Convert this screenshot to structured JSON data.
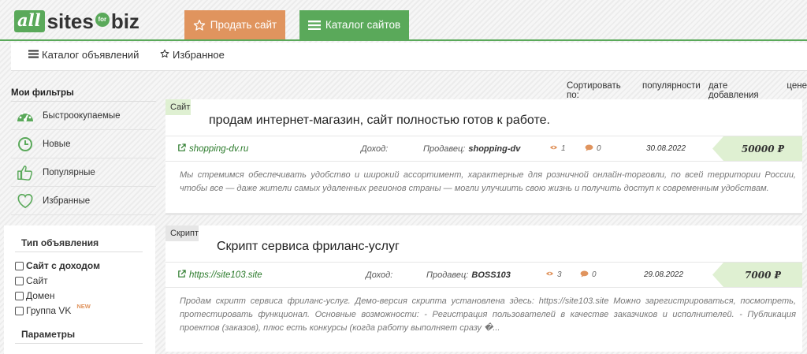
{
  "logo": {
    "part1": "all",
    "part2": "sites",
    "part3": "for",
    "part4": "biz"
  },
  "header": {
    "sell_label": "Продать сайт",
    "catalog_label": "Каталог сайтов"
  },
  "nav": {
    "catalog_ads": "Каталог объявлений",
    "favorites": "Избранное"
  },
  "sidebar": {
    "my_filters_title": "Мои фильтры",
    "filters": [
      {
        "label": "Быстроокупаемые",
        "icon": "speedometer-icon"
      },
      {
        "label": "Новые",
        "icon": "clock-icon"
      },
      {
        "label": "Популярные",
        "icon": "thumbs-up-icon"
      },
      {
        "label": "Избранные",
        "icon": "heart-icon"
      }
    ],
    "ad_type_title": "Тип объявления",
    "ad_types": [
      {
        "label": "Сайт с доходом",
        "bold": true,
        "checked": false
      },
      {
        "label": "Сайт",
        "checked": false
      },
      {
        "label": "Домен",
        "checked": false
      },
      {
        "label": "Группа VK",
        "checked": false,
        "badge": "NEW"
      }
    ],
    "params_title": "Параметры"
  },
  "sort": {
    "label": "Сортировать по:",
    "options": [
      "популярности",
      "дате добавления",
      "цене"
    ]
  },
  "listings": [
    {
      "category": "Сайт",
      "title": "продам интернет-магазин, сайт полностью готов к работе.",
      "site": "shopping-dv.ru",
      "income_label": "Доход:",
      "seller_label": "Продавец:",
      "seller": "shopping-dv",
      "views": "1",
      "comments": "0",
      "date": "30.08.2022",
      "price": "50000 ₽",
      "description": "Мы стремимся обеспечивать удобство и широкий ассортимент, характерные для розничной онлайн-торговли, по всей территории России, чтобы все — даже жители самых удаленных регионов страны — могли улучшить свою жизнь и получить доступ к современным удобствам."
    },
    {
      "category": "Скрипт",
      "title": "Скрипт сервиса фриланс-услуг",
      "site": "https://site103.site",
      "income_label": "Доход:",
      "seller_label": "Продавец:",
      "seller": "BOSS103",
      "views": "3",
      "comments": "0",
      "date": "29.08.2022",
      "price": "7000 ₽",
      "description": "Продам скрипт сервиса фриланс-услуг. Демо-версия скрипта установлена здесь: https://site103.site Можно зарегистрироваться, посмотреть, протестировать функционал. Основные возможности: - Регистрация пользователей в качестве заказчиков и исполнителей. - Публикация проектов (заказов), плюс есть конкурсы (когда работу выполняет сразу �..."
    }
  ],
  "colors": {
    "green": "#5aa95a",
    "orange": "#e0945e",
    "light_green": "#dff0d2"
  }
}
